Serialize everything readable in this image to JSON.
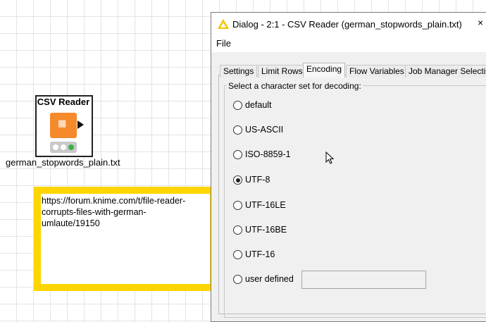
{
  "canvas": {
    "node": {
      "title": "CSV Reader",
      "label": "german_stopwords_plain.txt",
      "icon": "table-icon",
      "status_colors": [
        "#ffffff",
        "#ffffff",
        "#39b54a"
      ]
    },
    "annotation": {
      "text": "https://forum.knime.com/t/file-reader-corrupts-files-with-german-umlaute/19150",
      "border_color": "#ffd500"
    }
  },
  "dialog": {
    "title": "Dialog - 2:1 - CSV Reader (german_stopwords_plain.txt)",
    "close_label": "×",
    "menu": {
      "file": "File"
    },
    "tabs": [
      {
        "label": "Settings"
      },
      {
        "label": "Limit Rows"
      },
      {
        "label": "Encoding"
      },
      {
        "label": "Flow Variables"
      },
      {
        "label": "Job Manager Selection"
      }
    ],
    "active_tab": "Encoding",
    "encoding": {
      "legend": "Select a character set for decoding:",
      "options": [
        {
          "label": "default"
        },
        {
          "label": "US-ASCII"
        },
        {
          "label": "ISO-8859-1"
        },
        {
          "label": "UTF-8"
        },
        {
          "label": "UTF-16LE"
        },
        {
          "label": "UTF-16BE"
        },
        {
          "label": "UTF-16"
        },
        {
          "label": "user defined"
        }
      ],
      "selected": "UTF-8",
      "user_defined_value": ""
    }
  }
}
